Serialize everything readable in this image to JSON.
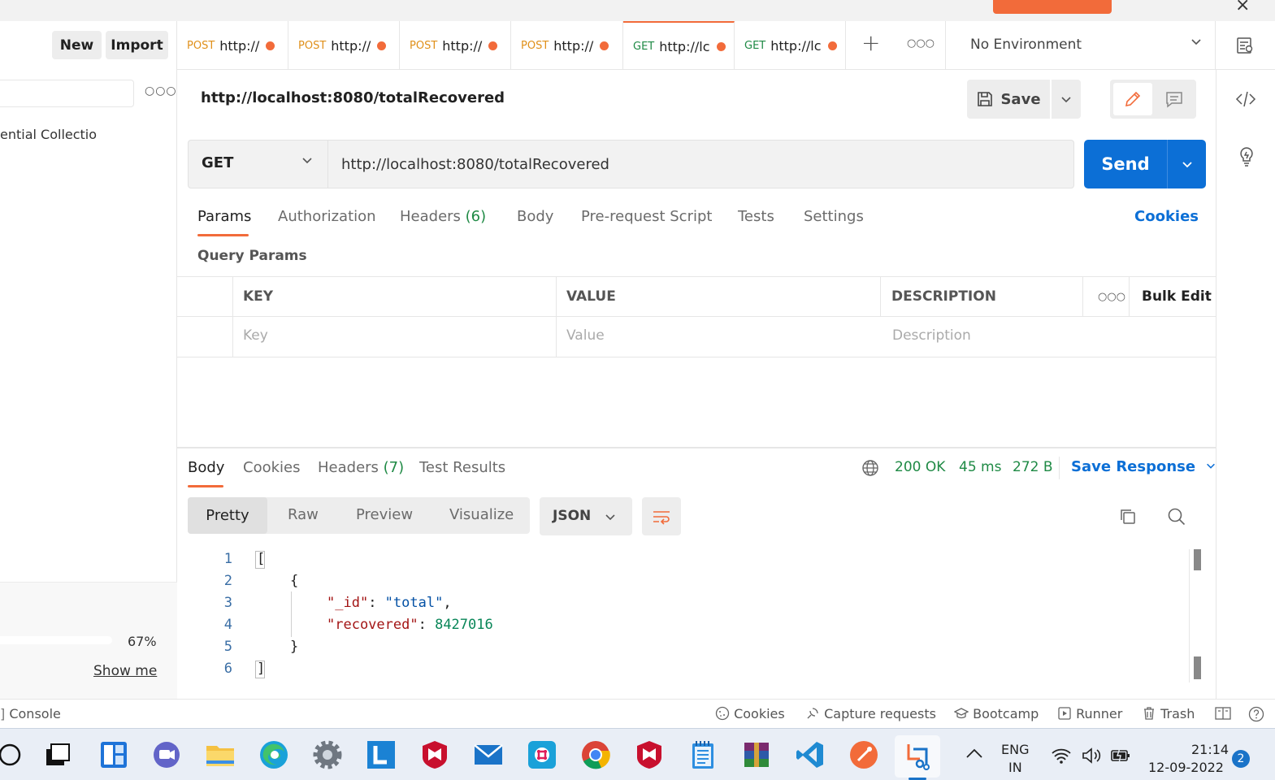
{
  "sidebar": {
    "new_label": "New",
    "import_label": "Import",
    "collection_label": "ential Collectio",
    "progress_percent": 67,
    "progress_label": "67%",
    "show_me_label": "Show me"
  },
  "tabs": [
    {
      "method": "POST",
      "label": "http://"
    },
    {
      "method": "POST",
      "label": "http://"
    },
    {
      "method": "POST",
      "label": "http://"
    },
    {
      "method": "POST",
      "label": "http://"
    },
    {
      "method": "GET",
      "label": "http://lc"
    },
    {
      "method": "GET",
      "label": "http://lc"
    }
  ],
  "environment": {
    "label": "No Environment"
  },
  "request": {
    "title": "http://localhost:8080/totalRecovered",
    "save_label": "Save",
    "method": "GET",
    "url": "http://localhost:8080/totalRecovered",
    "send_label": "Send",
    "tabs": {
      "params": "Params",
      "authorization": "Authorization",
      "headers": "Headers",
      "headers_count": "(6)",
      "body": "Body",
      "prerequest": "Pre-request Script",
      "tests": "Tests",
      "settings": "Settings"
    },
    "cookies_label": "Cookies",
    "query_params_title": "Query Params",
    "table": {
      "key_header": "KEY",
      "value_header": "VALUE",
      "description_header": "DESCRIPTION",
      "bulk_edit": "Bulk Edit",
      "key_placeholder": "Key",
      "value_placeholder": "Value",
      "description_placeholder": "Description"
    }
  },
  "response": {
    "tabs": {
      "body": "Body",
      "cookies": "Cookies",
      "headers": "Headers",
      "headers_count": "(7)",
      "test_results": "Test Results"
    },
    "status": "200 OK",
    "time": "45 ms",
    "size": "272 B",
    "save_response": "Save Response",
    "formats": {
      "pretty": "Pretty",
      "raw": "Raw",
      "preview": "Preview",
      "visualize": "Visualize"
    },
    "language": "JSON",
    "lines": [
      "1",
      "2",
      "3",
      "4",
      "5",
      "6"
    ],
    "code": {
      "open_bracket": "[",
      "open_brace": "{",
      "key_id": "\"_id\"",
      "val_id": "\"total\"",
      "key_recovered": "\"recovered\"",
      "val_recovered": "8427016",
      "close_brace": "}",
      "close_bracket": "]"
    }
  },
  "statusbar": {
    "console": "Console",
    "cookies": "Cookies",
    "capture": "Capture requests",
    "bootcamp": "Bootcamp",
    "runner": "Runner",
    "trash": "Trash"
  },
  "taskbar": {
    "lang_top": "ENG",
    "lang_bottom": "IN",
    "time": "21:14",
    "date": "12-09-2022",
    "notification_count": "2"
  },
  "colors": {
    "accent_orange": "#f26b3a",
    "send_blue": "#0c6fd6",
    "status_green": "#1f8a45"
  }
}
